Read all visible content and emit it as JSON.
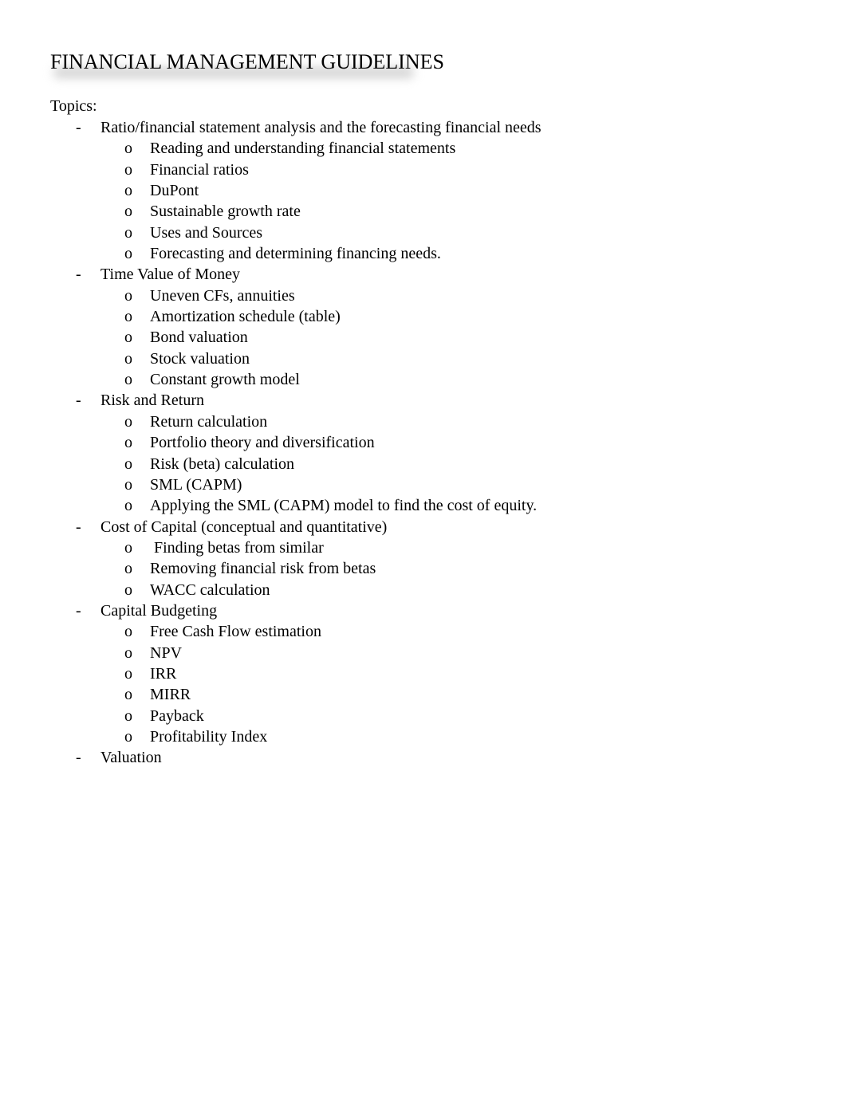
{
  "document": {
    "title": "FINANCIAL MANAGEMENT GUIDELINES",
    "topics_label": "Topics:",
    "bullet_markers": {
      "level1": "-",
      "level2": "o"
    },
    "topics": [
      {
        "label": "Ratio/financial statement analysis and the forecasting financial needs",
        "subtopics": [
          "Reading and understanding financial statements",
          "Financial ratios",
          "DuPont",
          "Sustainable growth rate",
          "Uses and Sources",
          "Forecasting and determining financing needs."
        ]
      },
      {
        "label": "Time Value of Money",
        "subtopics": [
          "Uneven CFs, annuities",
          "Amortization schedule (table)",
          "Bond valuation",
          "Stock valuation",
          "Constant growth model"
        ]
      },
      {
        "label": "Risk and Return",
        "subtopics": [
          "Return calculation",
          "Portfolio theory and diversification",
          "Risk (beta) calculation",
          "SML (CAPM)",
          "Applying the SML (CAPM) model to find the cost of equity."
        ]
      },
      {
        "label": "Cost of Capital (conceptual and quantitative)",
        "subtopics": [
          " Finding betas from similar",
          "Removing financial risk from betas",
          "WACC calculation"
        ]
      },
      {
        "label": "Capital Budgeting",
        "subtopics": [
          "Free Cash Flow estimation",
          "NPV",
          "IRR",
          "MIRR",
          "Payback",
          "Profitability Index"
        ]
      },
      {
        "label": "Valuation",
        "subtopics": []
      }
    ]
  }
}
